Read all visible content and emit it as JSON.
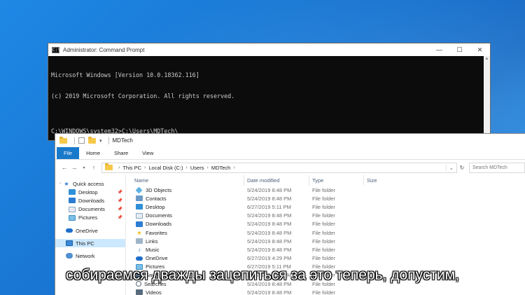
{
  "colors": {
    "desktop": "#1976d2",
    "ribbon_file": "#1979ca",
    "selected": "#cce8ff"
  },
  "cmd": {
    "title": "Administrator: Command Prompt",
    "icon_label": "C:\\",
    "lines": [
      "Microsoft Windows [Version 10.0.18362.116]",
      "(c) 2019 Microsoft Corporation. All rights reserved.",
      "",
      "C:\\WINDOWS\\system32>C:\\Users\\MDTech\\"
    ],
    "minimize_glyph": "—",
    "maximize_glyph": "☐",
    "close_glyph": "✕"
  },
  "explorer": {
    "title": "MDTech",
    "ribbon_tabs": [
      "File",
      "Home",
      "Share",
      "View"
    ],
    "address": [
      "This PC",
      "Local Disk (C:)",
      "Users",
      "MDTech"
    ],
    "search_placeholder": "Search MDTech",
    "columns": {
      "name": "Name",
      "date": "Date modified",
      "type": "Type",
      "size": "Size"
    },
    "nav": [
      {
        "label": "Quick access",
        "icon": "star-icon"
      },
      {
        "label": "Desktop",
        "icon": "desktop-icon",
        "pinned": true
      },
      {
        "label": "Downloads",
        "icon": "downloads-icon",
        "pinned": true
      },
      {
        "label": "Documents",
        "icon": "documents-icon",
        "pinned": true
      },
      {
        "label": "Pictures",
        "icon": "pictures-icon",
        "pinned": true
      },
      {
        "label": "OneDrive",
        "icon": "onedrive-icon"
      },
      {
        "label": "This PC",
        "icon": "this-pc-icon",
        "selected": true
      },
      {
        "label": "Network",
        "icon": "network-icon"
      }
    ],
    "files": [
      {
        "name": "3D Objects",
        "date": "5/24/2019 8:48 PM",
        "type": "File folder"
      },
      {
        "name": "Contacts",
        "date": "5/24/2019 8:48 PM",
        "type": "File folder"
      },
      {
        "name": "Desktop",
        "date": "6/27/2019 5:11 PM",
        "type": "File folder"
      },
      {
        "name": "Documents",
        "date": "5/24/2019 8:48 PM",
        "type": "File folder"
      },
      {
        "name": "Downloads",
        "date": "5/24/2019 8:48 PM",
        "type": "File folder"
      },
      {
        "name": "Favorites",
        "date": "5/24/2019 8:48 PM",
        "type": "File folder"
      },
      {
        "name": "Links",
        "date": "5/24/2019 8:48 PM",
        "type": "File folder"
      },
      {
        "name": "Music",
        "date": "5/24/2019 8:48 PM",
        "type": "File folder"
      },
      {
        "name": "OneDrive",
        "date": "6/27/2019 4:29 PM",
        "type": "File folder"
      },
      {
        "name": "Pictures",
        "date": "6/27/2019 5:11 PM",
        "type": "File folder"
      },
      {
        "name": "Saved Games",
        "date": "5/24/2019 8:48 PM",
        "type": "File folder"
      },
      {
        "name": "Searches",
        "date": "5/24/2019 8:48 PM",
        "type": "File folder"
      },
      {
        "name": "Videos",
        "date": "5/24/2019 8:48 PM",
        "type": "File folder"
      }
    ]
  },
  "subtitle": "собираемся дважды зацепиться за это теперь, допустим,"
}
